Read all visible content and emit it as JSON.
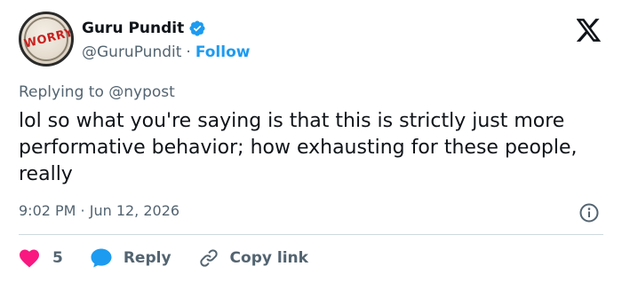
{
  "author": {
    "display_name": "Guru Pundit",
    "handle": "@GuruPundit",
    "separator": "·",
    "follow_label": "Follow",
    "avatar_text": "WORRY"
  },
  "tweet": {
    "replying_to": "Replying to @nypost",
    "text": "lol so what you're saying is that this is strictly just more performative behavior; how exhausting for these people, really",
    "timestamp": "9:02 PM · Jun 12, 2026"
  },
  "actions": {
    "like_count": "5",
    "reply_label": "Reply",
    "copy_link_label": "Copy link"
  },
  "colors": {
    "accent": "#1d9bf0",
    "like": "#f91880",
    "text_secondary": "#536471",
    "text_primary": "#0f1419"
  },
  "icons": [
    "verified-badge-icon",
    "x-logo-icon",
    "info-icon",
    "heart-icon",
    "reply-bubble-icon",
    "link-icon"
  ]
}
